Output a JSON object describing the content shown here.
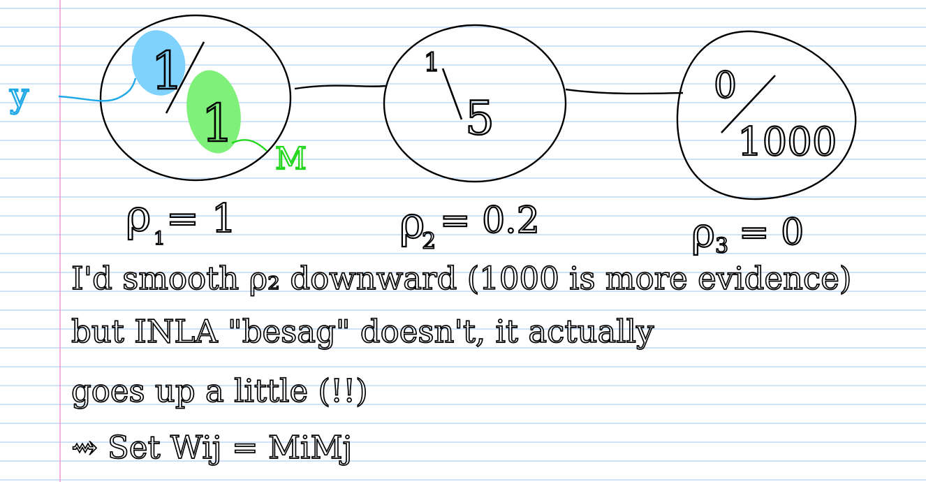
{
  "notebook": {
    "line_color": "#9cc7f2",
    "margin_color": "#f49ad8",
    "ink_color": "#000000"
  },
  "nodes": [
    {
      "id": "node-1",
      "numerator": "1",
      "denominator": "1",
      "rho_label": "ρ",
      "rho_subscript": "1",
      "rho_value": "= 1"
    },
    {
      "id": "node-2",
      "numerator": "1",
      "denominator": "5",
      "rho_label": "ρ",
      "rho_subscript": "2",
      "rho_value": "= 0.2"
    },
    {
      "id": "node-3",
      "numerator": "0",
      "denominator": "1000",
      "rho_label": "ρ",
      "rho_subscript": "3",
      "rho_value": "= 0"
    }
  ],
  "annotations": {
    "y_label": "y",
    "y_color": "#1fa8e6",
    "y_highlight_color": "#7fd2fb",
    "m_label": "M",
    "m_color": "#22d61b",
    "m_highlight_color": "#7ff07a"
  },
  "notes": {
    "line1": "I'd smooth ρ₂ downward (1000 is more evidence)",
    "line2": "but INLA \"besag\" doesn't, it actually",
    "line3": "goes up a little (!!)",
    "line4": "⇝ Set Wij = MiMj"
  }
}
